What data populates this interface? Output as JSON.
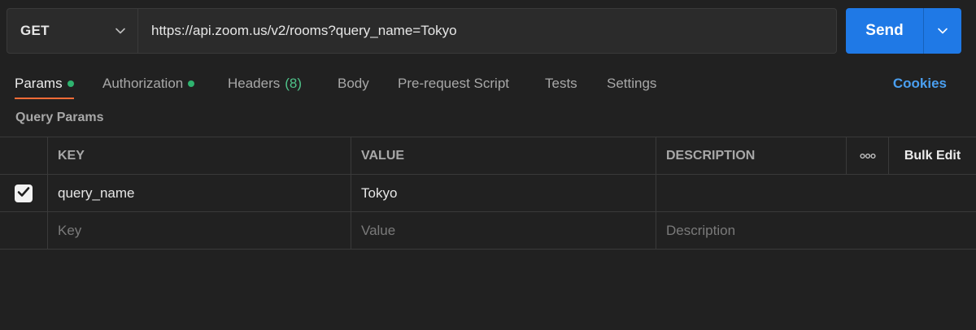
{
  "request": {
    "method": "GET",
    "url": "https://api.zoom.us/v2/rooms?query_name=Tokyo",
    "send_label": "Send"
  },
  "tabs": [
    {
      "label": "Params",
      "dot": true,
      "active": true
    },
    {
      "label": "Authorization",
      "dot": true
    },
    {
      "label": "Headers",
      "count": "(8)"
    },
    {
      "label": "Body"
    },
    {
      "label": "Pre-request Script"
    },
    {
      "label": "Tests"
    },
    {
      "label": "Settings"
    }
  ],
  "cookies_label": "Cookies",
  "section_title": "Query Params",
  "table": {
    "headers": {
      "key": "KEY",
      "value": "VALUE",
      "description": "DESCRIPTION",
      "more": "ooo",
      "bulk_edit": "Bulk Edit"
    },
    "rows": [
      {
        "checked": true,
        "key": "query_name",
        "value": "Tokyo",
        "description": ""
      }
    ],
    "new_row": {
      "key_placeholder": "Key",
      "value_placeholder": "Value",
      "description_placeholder": "Description"
    }
  },
  "colors": {
    "accent_tab": "#ff6c37",
    "send": "#1f79e6",
    "status_dot": "#2fb36f",
    "link": "#4a9ff0"
  },
  "icons": {
    "method_dropdown": "chevron-down-icon",
    "send_dropdown": "chevron-down-icon",
    "checkbox": "checkmark-icon",
    "more": "more-options-icon"
  }
}
